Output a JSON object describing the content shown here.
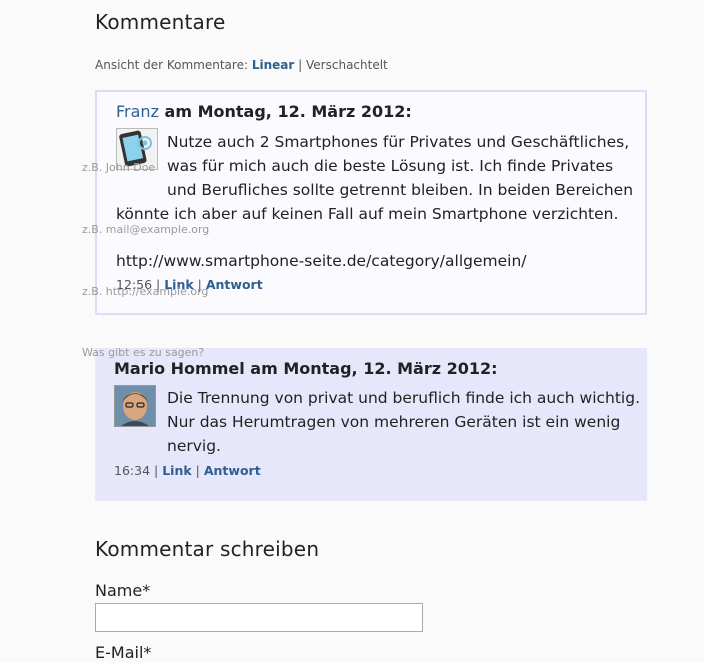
{
  "comments_section": {
    "heading": "Kommentare",
    "view_label": "Ansicht der Kommentare:",
    "view_linear": "Linear",
    "view_separator": "|",
    "view_nested": "Verschachtelt"
  },
  "comments": [
    {
      "author": "Franz",
      "date_text": "am Montag, 12. März 2012:",
      "text_lines": [
        "Nutze auch 2 Smartphones für Privates und Geschäftliches,",
        "was für mich auch die beste Lösung ist. Ich finde Privates",
        "und Berufliches sollte getrennt bleiben. In beiden Bereichen",
        "könnte ich aber auf keinen Fall auf mein Smartphone verzichten."
      ],
      "url": "http://www.smartphone-seite.de/category/allgemein/",
      "time": "12:56",
      "link_label": "Link",
      "reply_label": "Antwort"
    },
    {
      "author": "Mario Hommel",
      "date_text": "am Montag, 12. März 2012:",
      "text_lines": [
        "Die Trennung von privat und beruflich finde ich auch wichtig.",
        "Nur das Herumtragen von mehreren Geräten ist ein wenig",
        "nervig."
      ],
      "time": "16:34",
      "link_label": "Link",
      "reply_label": "Antwort"
    }
  ],
  "placeholders": {
    "name": "z.B. John Doe",
    "email": "z.B. mail@example.org",
    "website": "z.B. http://example.org",
    "comment": "Was gibt es zu sagen?"
  },
  "form": {
    "heading": "Kommentar schreiben",
    "name_label": "Name*",
    "name_value": "",
    "email_label": "E-Mail*"
  },
  "colors": {
    "link": "#2f5f8f",
    "reply_box_bg": "#e7e7fb",
    "comment_border": "#dcdcf7"
  }
}
